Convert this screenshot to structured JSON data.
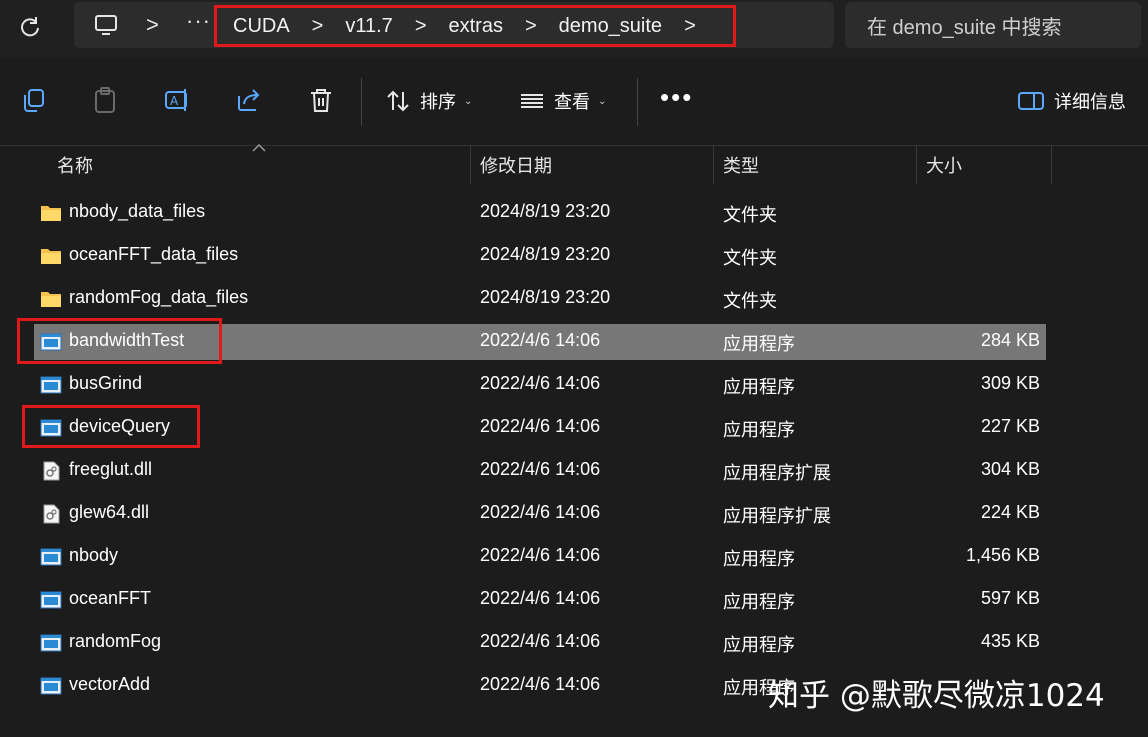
{
  "addressbar": {
    "crumbs": [
      "CUDA",
      "v11.7",
      "extras",
      "demo_suite"
    ],
    "chevron": ">",
    "overflow": "···",
    "search_placeholder": "在 demo_suite 中搜索"
  },
  "toolbar": {
    "sort_label": "排序",
    "view_label": "查看",
    "more_label": "•••",
    "details_label": "详细信息"
  },
  "columns": [
    "名称",
    "修改日期",
    "类型",
    "大小"
  ],
  "files": [
    {
      "icon": "folder-icon",
      "name": "nbody_data_files",
      "date": "2024/8/19 23:20",
      "type": "文件夹",
      "size": ""
    },
    {
      "icon": "folder-icon",
      "name": "oceanFFT_data_files",
      "date": "2024/8/19 23:20",
      "type": "文件夹",
      "size": ""
    },
    {
      "icon": "folder-icon",
      "name": "randomFog_data_files",
      "date": "2024/8/19 23:20",
      "type": "文件夹",
      "size": ""
    },
    {
      "icon": "exe-icon",
      "name": "bandwidthTest",
      "date": "2022/4/6 14:06",
      "type": "应用程序",
      "size": "284 KB",
      "selected": true
    },
    {
      "icon": "exe-icon",
      "name": "busGrind",
      "date": "2022/4/6 14:06",
      "type": "应用程序",
      "size": "309 KB"
    },
    {
      "icon": "exe-icon",
      "name": "deviceQuery",
      "date": "2022/4/6 14:06",
      "type": "应用程序",
      "size": "227 KB"
    },
    {
      "icon": "dll-icon",
      "name": "freeglut.dll",
      "date": "2022/4/6 14:06",
      "type": "应用程序扩展",
      "size": "304 KB"
    },
    {
      "icon": "dll-icon",
      "name": "glew64.dll",
      "date": "2022/4/6 14:06",
      "type": "应用程序扩展",
      "size": "224 KB"
    },
    {
      "icon": "exe-icon",
      "name": "nbody",
      "date": "2022/4/6 14:06",
      "type": "应用程序",
      "size": "1,456 KB"
    },
    {
      "icon": "exe-icon",
      "name": "oceanFFT",
      "date": "2022/4/6 14:06",
      "type": "应用程序",
      "size": "597 KB"
    },
    {
      "icon": "exe-icon",
      "name": "randomFog",
      "date": "2022/4/6 14:06",
      "type": "应用程序",
      "size": "435 KB"
    },
    {
      "icon": "exe-icon",
      "name": "vectorAdd",
      "date": "2022/4/6 14:06",
      "type": "应用程序",
      "size": ""
    }
  ],
  "watermark": "知乎 @默歌尽微凉1024",
  "colors": {
    "background": "#1c1c1c",
    "selected_row": "#777777",
    "highlight_box": "#e0191b",
    "folder": "#f4c04e",
    "exe_blue": "#2a8ad4"
  }
}
